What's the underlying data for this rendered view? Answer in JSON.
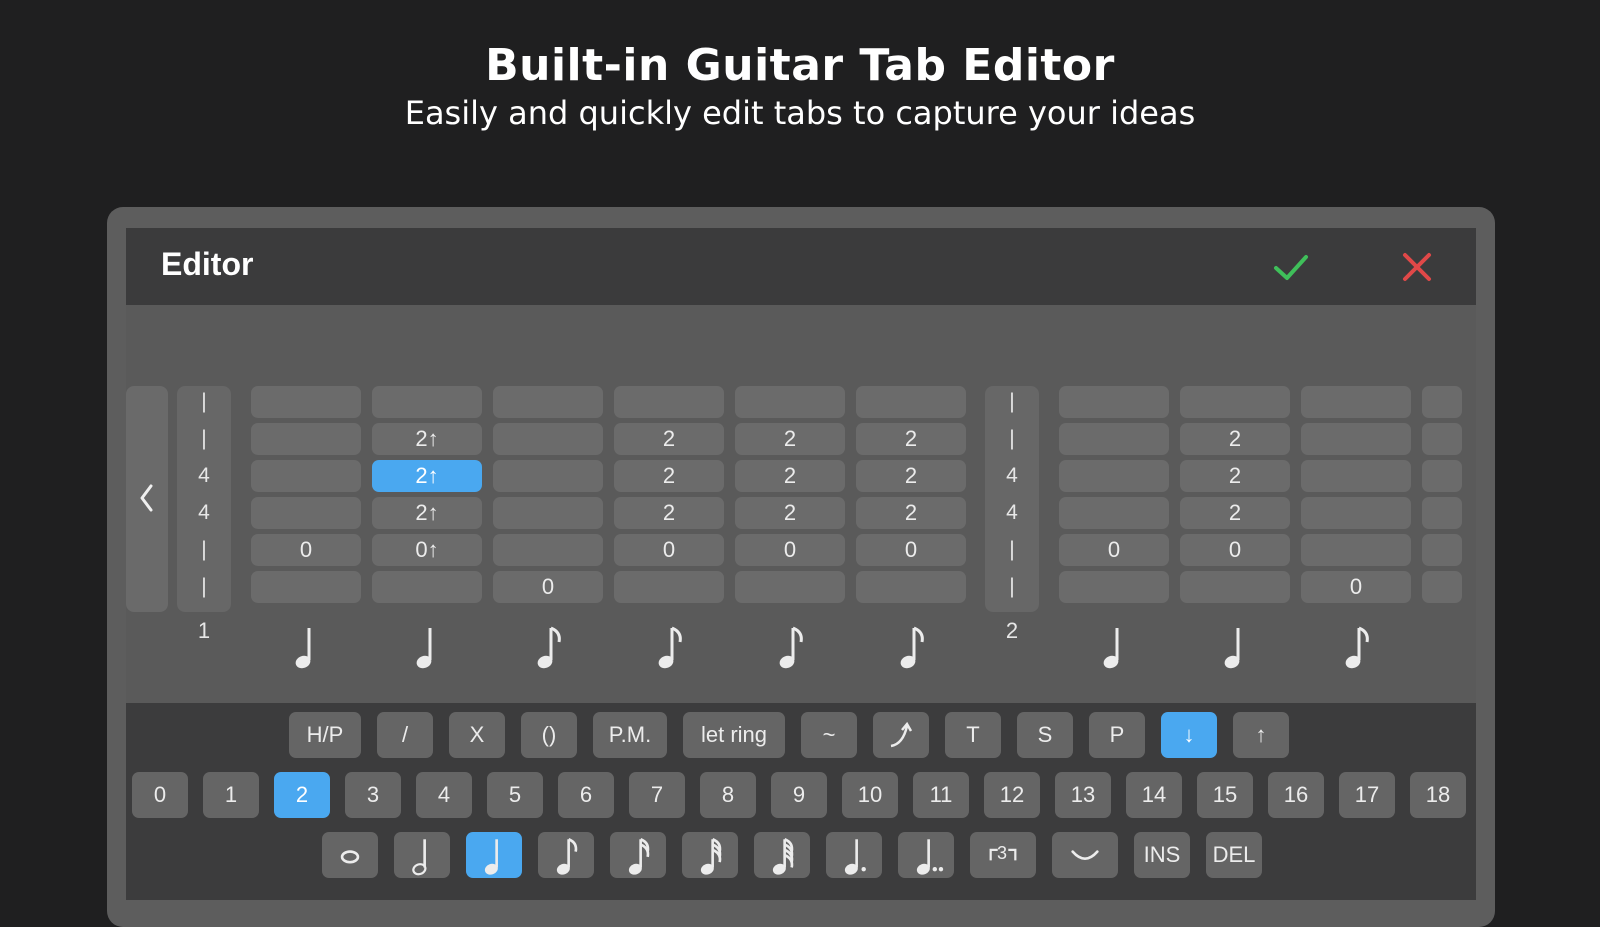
{
  "hero": {
    "title": "Built-in Guitar Tab Editor",
    "subtitle": "Easily and quickly edit tabs to capture your ideas"
  },
  "editor": {
    "title": "Editor",
    "confirm_icon": "check-icon",
    "close_icon": "close-x-icon",
    "prev_icon": "chevron-left-icon",
    "colors": {
      "accent": "#4aa8f0",
      "confirm": "#3fbf5a",
      "close": "#e04848"
    }
  },
  "tab": {
    "measures": [
      {
        "number": "1",
        "labels": [
          "|",
          "|",
          "4",
          "4",
          "|",
          "|"
        ]
      },
      {
        "number": "2",
        "labels": [
          "|",
          "|",
          "4",
          "4",
          "|",
          "|"
        ]
      }
    ],
    "beats": [
      {
        "strings": [
          "",
          "",
          "",
          "",
          "0",
          ""
        ],
        "duration": "quarter"
      },
      {
        "strings": [
          "",
          "2↑",
          "2↑",
          "2↑",
          "0↑",
          ""
        ],
        "duration": "quarter",
        "selected_string": 2
      },
      {
        "strings": [
          "",
          "",
          "",
          "",
          "",
          "0"
        ],
        "duration": "eighth"
      },
      {
        "strings": [
          "",
          "2",
          "2",
          "2",
          "0",
          ""
        ],
        "duration": "eighth"
      },
      {
        "strings": [
          "",
          "2",
          "2",
          "2",
          "0",
          ""
        ],
        "duration": "eighth"
      },
      {
        "strings": [
          "",
          "2",
          "2",
          "2",
          "0",
          ""
        ],
        "duration": "eighth"
      },
      {
        "strings": [
          "",
          "",
          "",
          "",
          "0",
          ""
        ],
        "duration": "quarter"
      },
      {
        "strings": [
          "",
          "2",
          "2",
          "2",
          "0",
          ""
        ],
        "duration": "quarter"
      },
      {
        "strings": [
          "",
          "",
          "",
          "",
          "",
          "0"
        ],
        "duration": "eighth"
      }
    ]
  },
  "keyboard": {
    "effects": [
      {
        "label": "H/P"
      },
      {
        "label": "/"
      },
      {
        "label": "X"
      },
      {
        "label": "()"
      },
      {
        "label": "P.M."
      },
      {
        "label": "let ring"
      },
      {
        "label": "~"
      },
      {
        "label": "",
        "icon": "bend-icon"
      },
      {
        "label": "T"
      },
      {
        "label": "S"
      },
      {
        "label": "P"
      },
      {
        "label": "↓",
        "active": true
      },
      {
        "label": "↑"
      }
    ],
    "frets": [
      "0",
      "1",
      "2",
      "3",
      "4",
      "5",
      "6",
      "7",
      "8",
      "9",
      "10",
      "11",
      "12",
      "13",
      "14",
      "15",
      "16",
      "17",
      "18"
    ],
    "active_fret": "2",
    "durations": [
      {
        "icon": "whole-note-icon"
      },
      {
        "icon": "half-note-icon"
      },
      {
        "icon": "quarter-note-icon",
        "active": true
      },
      {
        "icon": "eighth-note-icon"
      },
      {
        "icon": "sixteenth-note-icon"
      },
      {
        "icon": "thirty-second-note-icon"
      },
      {
        "icon": "sixty-fourth-note-icon"
      },
      {
        "icon": "dotted-note-icon"
      },
      {
        "icon": "double-dotted-note-icon"
      },
      {
        "icon": "triplet-icon",
        "label": "3"
      },
      {
        "icon": "tie-icon"
      },
      {
        "label": "INS"
      },
      {
        "label": "DEL"
      }
    ]
  }
}
